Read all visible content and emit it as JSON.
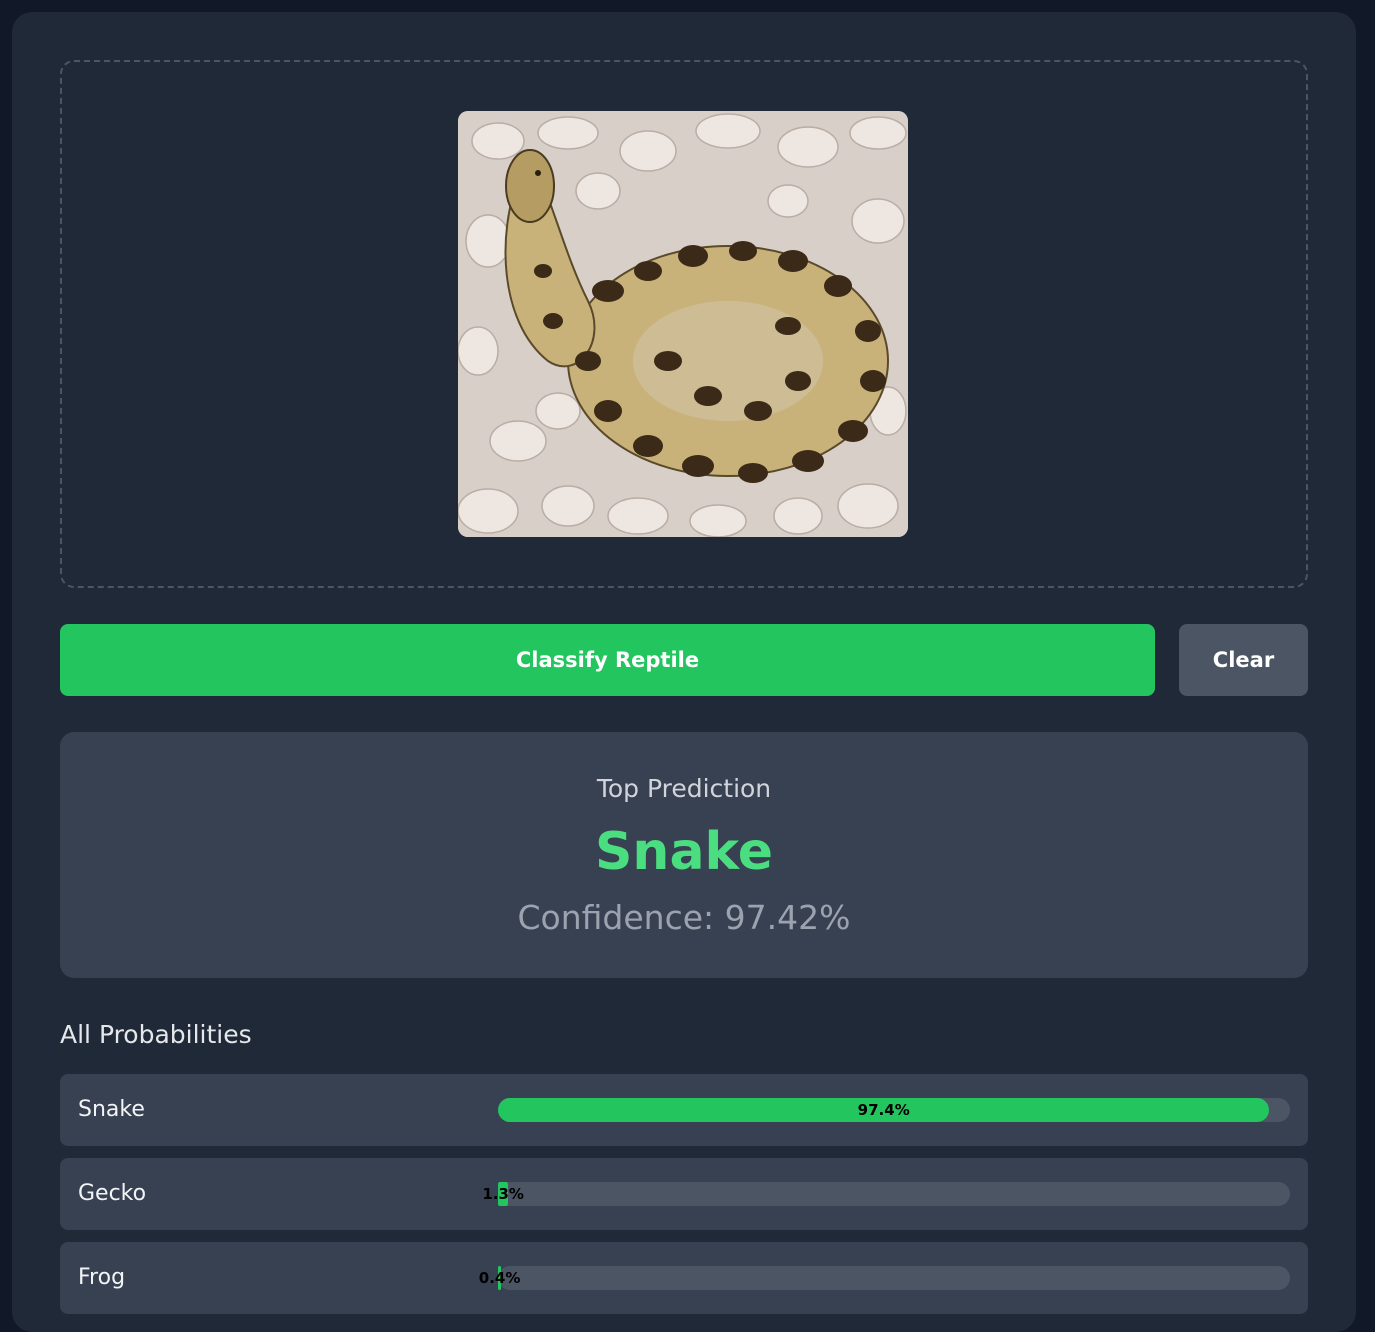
{
  "upload": {
    "image_alt": "Uploaded reptile image"
  },
  "actions": {
    "classify_label": "Classify Reptile",
    "clear_label": "Clear"
  },
  "result": {
    "heading": "Top Prediction",
    "label": "Snake",
    "confidence_text": "Confidence: 97.42%"
  },
  "probabilities": {
    "title": "All Probabilities",
    "items": [
      {
        "name": "Snake",
        "value_text": "97.4%",
        "percent": 97.4
      },
      {
        "name": "Gecko",
        "value_text": "1.3%",
        "percent": 1.3
      },
      {
        "name": "Frog",
        "value_text": "0.4%",
        "percent": 0.4
      }
    ]
  },
  "colors": {
    "accent": "#22c55e",
    "prediction": "#4ade80",
    "card": "#1f2937",
    "panel": "#374151",
    "track": "#4b5563"
  }
}
